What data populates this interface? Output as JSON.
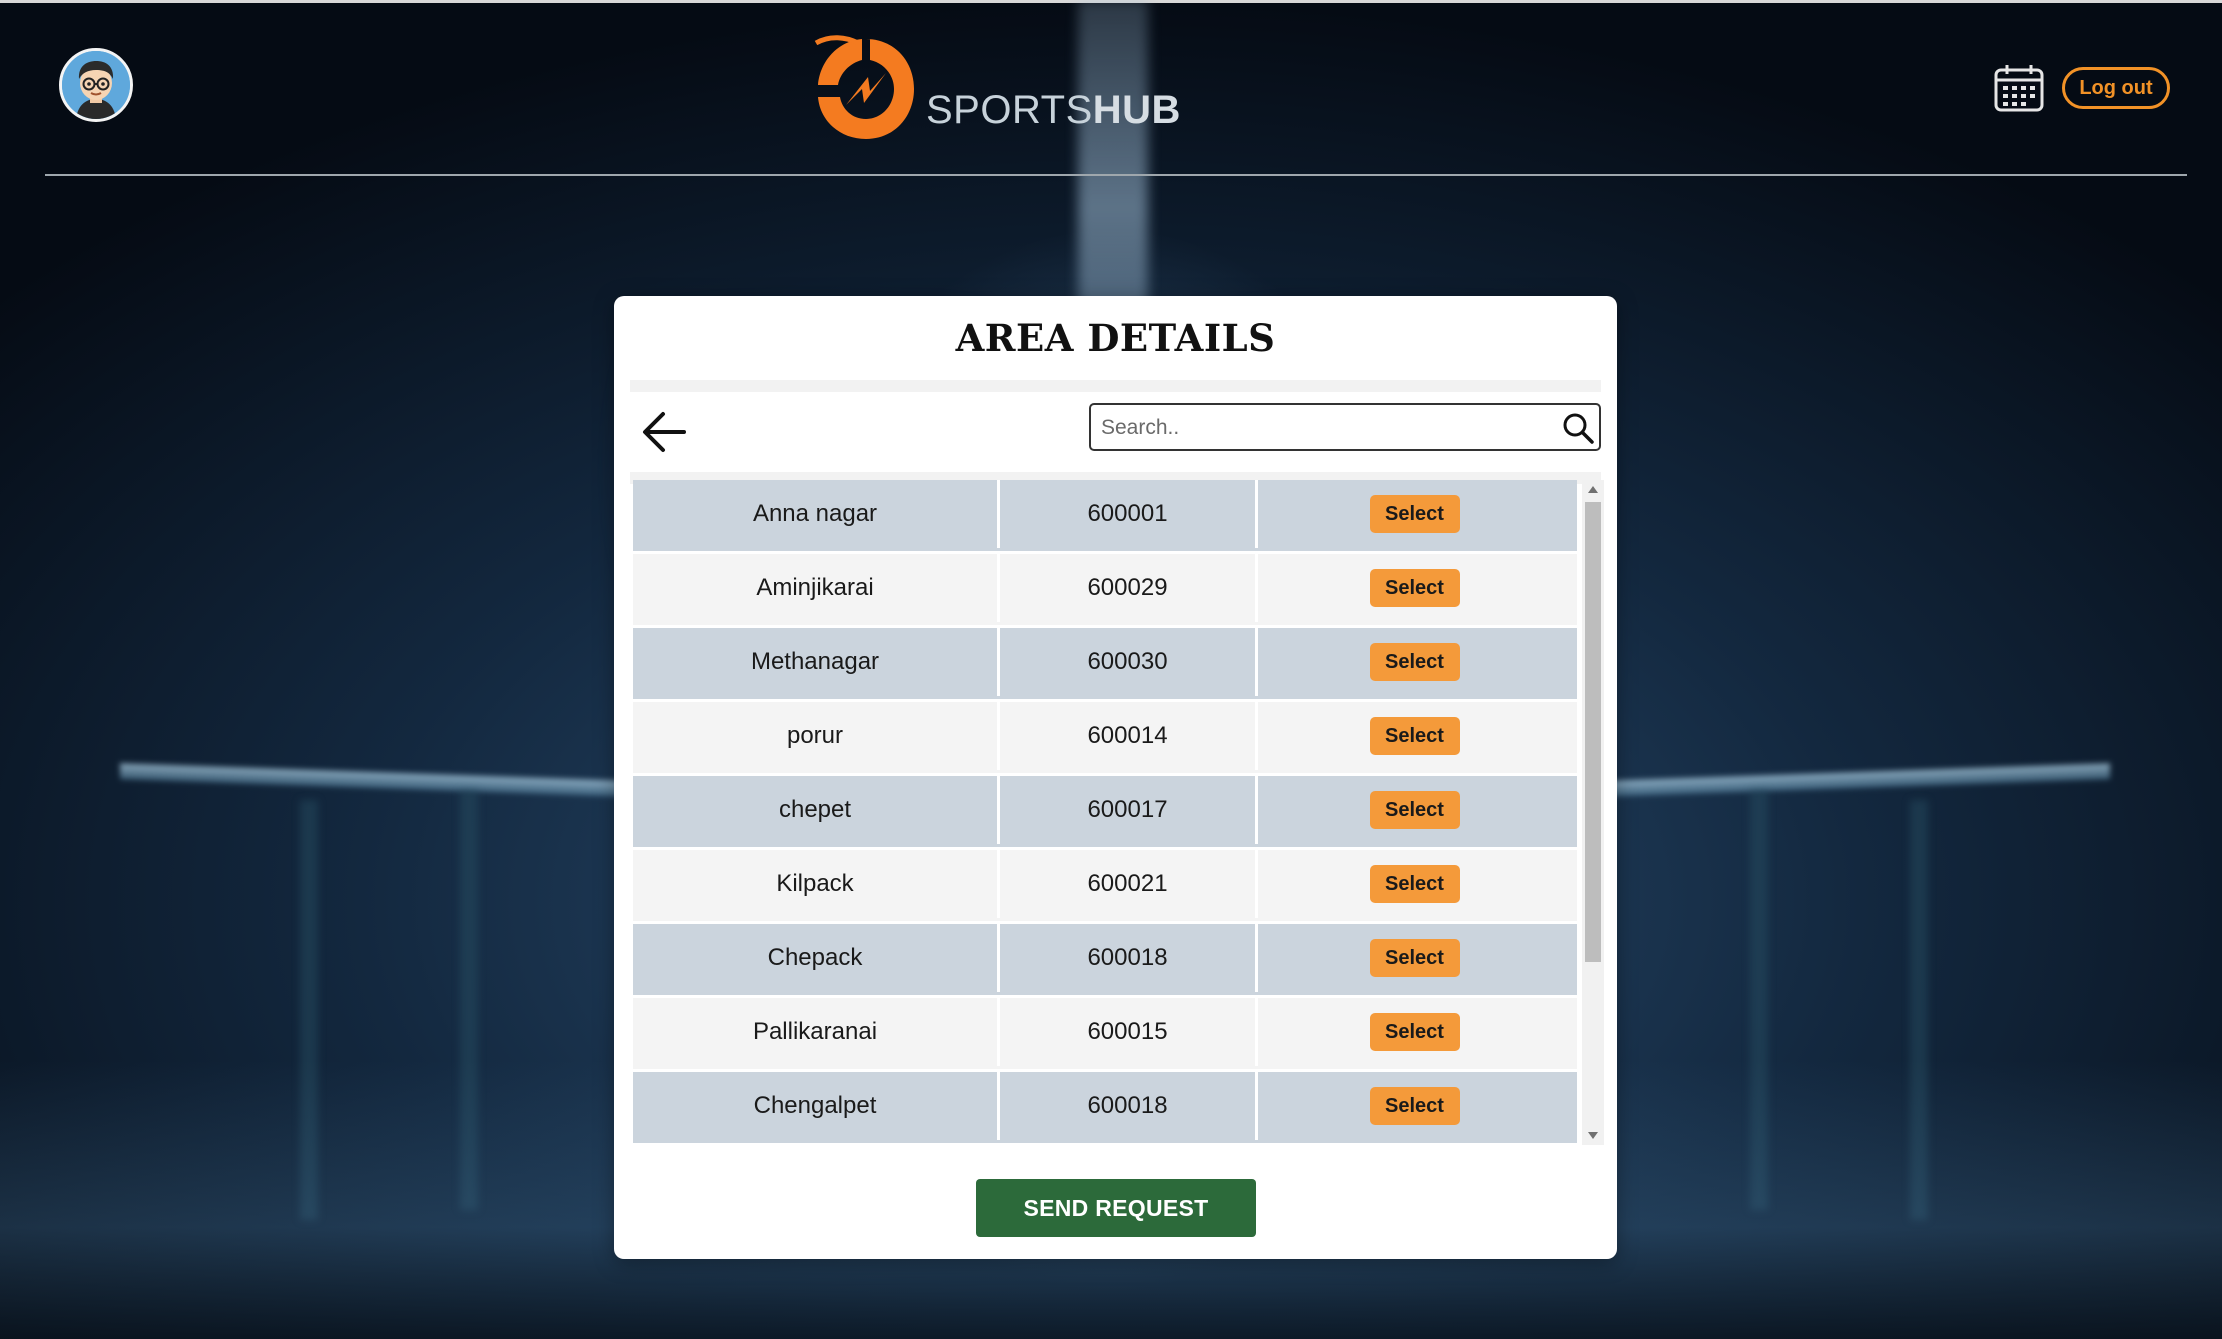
{
  "header": {
    "brand_prefix": "SPORTS",
    "brand_suffix": "HUB",
    "logout_label": "Log out"
  },
  "colors": {
    "accent": "#f29227",
    "send_button": "#2c6a3a",
    "row_shaded": "#cbd4dd",
    "row_plain": "#f4f4f4"
  },
  "icons": {
    "avatar": "avatar-icon",
    "calendar": "calendar-icon",
    "back": "arrow-left-icon",
    "search": "search-icon"
  },
  "card": {
    "title": "AREA DETAILS",
    "search_placeholder": "Search..",
    "select_label": "Select",
    "send_label": "SEND REQUEST"
  },
  "areas": [
    {
      "name": "Anna nagar",
      "pincode": "600001"
    },
    {
      "name": "Aminjikarai",
      "pincode": "600029"
    },
    {
      "name": "Methanagar",
      "pincode": "600030"
    },
    {
      "name": "porur",
      "pincode": "600014"
    },
    {
      "name": "chepet",
      "pincode": "600017"
    },
    {
      "name": "Kilpack",
      "pincode": "600021"
    },
    {
      "name": "Chepack",
      "pincode": "600018"
    },
    {
      "name": "Pallikaranai",
      "pincode": "600015"
    },
    {
      "name": "Chengalpet",
      "pincode": "600018"
    }
  ]
}
